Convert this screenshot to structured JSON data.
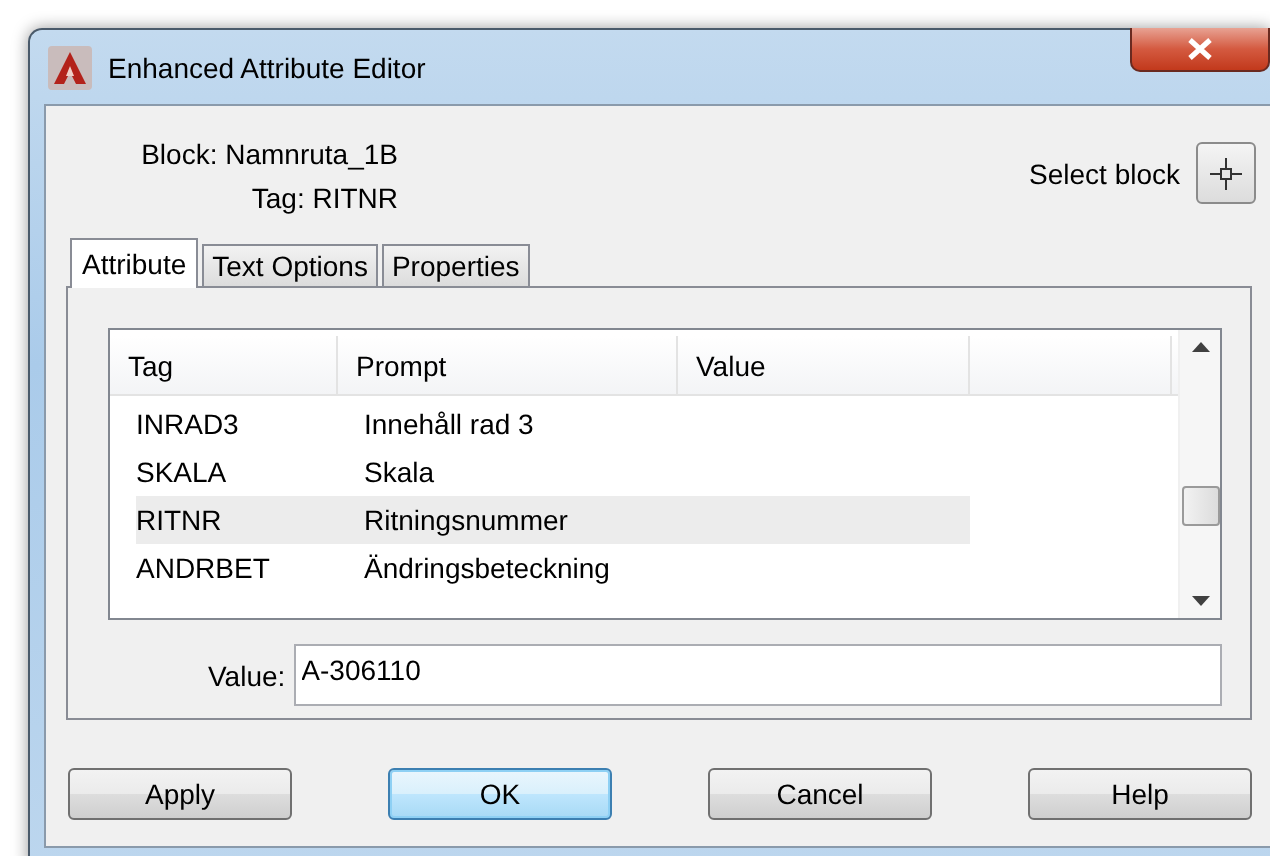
{
  "window": {
    "title": "Enhanced Attribute Editor"
  },
  "block_info": "Block: Namnruta_1B",
  "tag_info": "Tag: RITNR",
  "select_block": {
    "label": "Select block"
  },
  "tabs": [
    {
      "label": "Attribute",
      "selected": true
    },
    {
      "label": "Text Options",
      "selected": false
    },
    {
      "label": "Properties",
      "selected": false
    }
  ],
  "table": {
    "columns": [
      "Tag",
      "Prompt",
      "Value"
    ],
    "rows": [
      {
        "tag": "INRAD3",
        "prompt": "Innehåll rad 3",
        "selected": false
      },
      {
        "tag": "SKALA",
        "prompt": "Skala",
        "selected": false
      },
      {
        "tag": "RITNR",
        "prompt": "Ritningsnummer",
        "selected": true
      },
      {
        "tag": "ANDRBET",
        "prompt": "Ändringsbeteckning",
        "selected": false
      }
    ]
  },
  "value_field": {
    "label": "Value:",
    "value": "A-306110"
  },
  "buttons": [
    {
      "label": "Apply",
      "default": false
    },
    {
      "label": "OK",
      "default": true
    },
    {
      "label": "Cancel",
      "default": false
    },
    {
      "label": "Help",
      "default": false
    }
  ]
}
